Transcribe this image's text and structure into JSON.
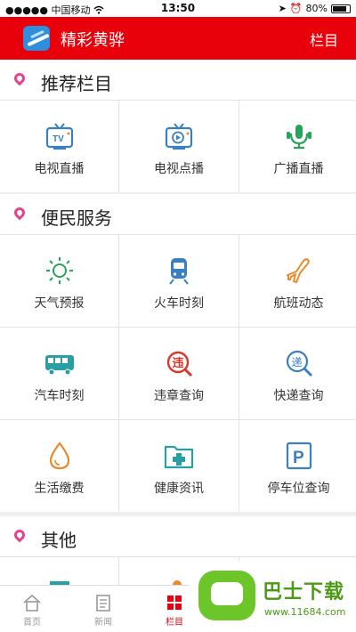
{
  "status_bar": {
    "carrier": "●●●●● 中国移动",
    "time": "13:50",
    "battery": "80%"
  },
  "header": {
    "title": "精彩黄骅",
    "menu_label": "栏目"
  },
  "sections": [
    {
      "title": "推荐栏目",
      "items": [
        {
          "label": "电视直播",
          "icon": "tv-live-icon"
        },
        {
          "label": "电视点播",
          "icon": "tv-vod-icon"
        },
        {
          "label": "广播直播",
          "icon": "radio-mic-icon"
        }
      ]
    },
    {
      "title": "便民服务",
      "items": [
        {
          "label": "天气预报",
          "icon": "sun-icon"
        },
        {
          "label": "火车时刻",
          "icon": "train-icon"
        },
        {
          "label": "航班动态",
          "icon": "airplane-icon"
        },
        {
          "label": "汽车时刻",
          "icon": "bus-icon"
        },
        {
          "label": "违章查询",
          "icon": "traffic-violation-icon"
        },
        {
          "label": "快递查询",
          "icon": "express-search-icon"
        },
        {
          "label": "生活缴费",
          "icon": "water-drop-icon"
        },
        {
          "label": "健康资讯",
          "icon": "medical-folder-icon"
        },
        {
          "label": "停车位查询",
          "icon": "parking-icon"
        }
      ]
    },
    {
      "title": "其他",
      "items": []
    }
  ],
  "tabbar": {
    "items": [
      {
        "label": "首页",
        "icon": "home-icon"
      },
      {
        "label": "新闻",
        "icon": "news-icon"
      },
      {
        "label": "栏目",
        "icon": "grid-icon",
        "active": true
      }
    ]
  },
  "watermark": {
    "title": "巴士下载",
    "url": "www.11684.com"
  },
  "colors": {
    "header_bg": "#e8000a",
    "section_pin": "#e2448f",
    "icon_blue": "#3a7fc1",
    "icon_green": "#2aa35a",
    "icon_orange": "#e8892b",
    "icon_red": "#d9372b",
    "active_tab": "#e60012"
  }
}
